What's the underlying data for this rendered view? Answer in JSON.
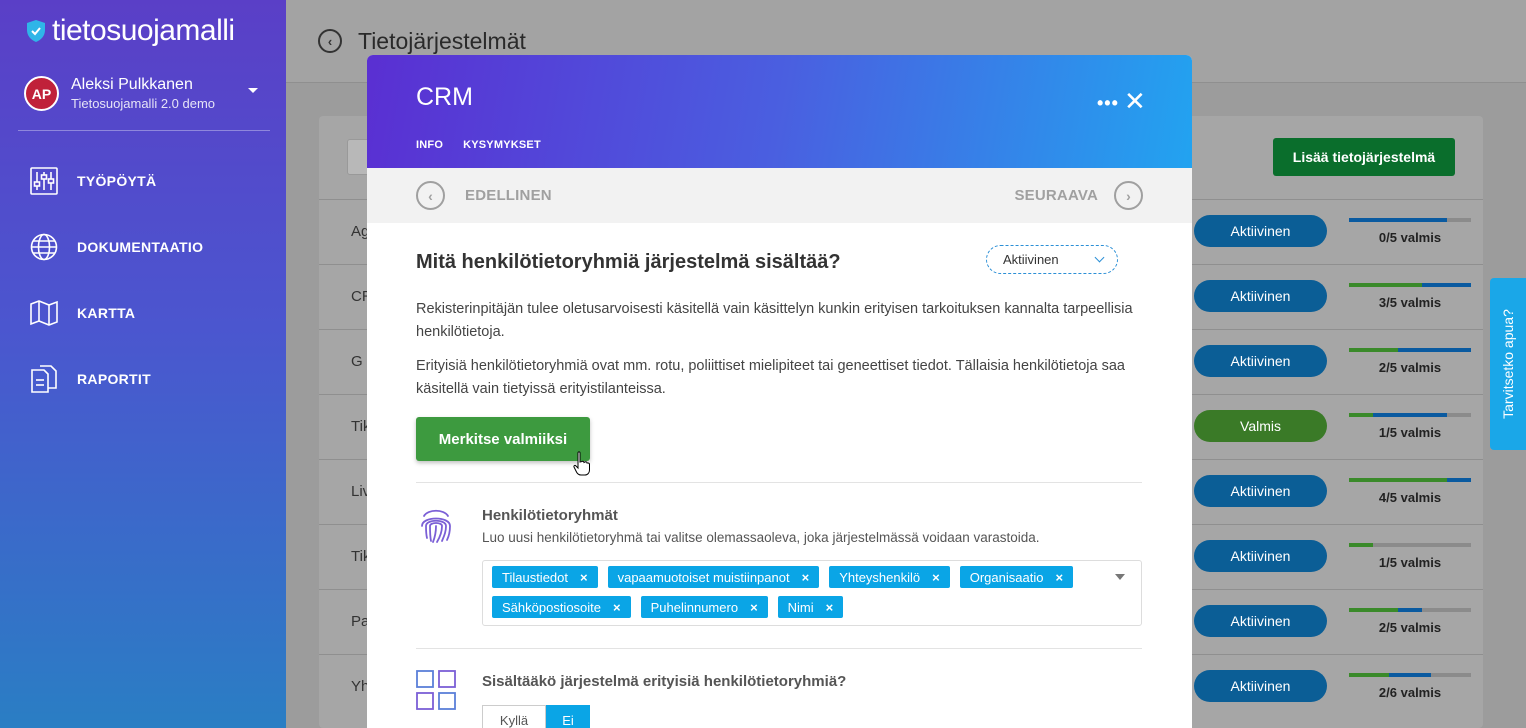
{
  "sidebar": {
    "logo": "tietosuojamalli",
    "user": {
      "initials": "AP",
      "name": "Aleksi Pulkkanen",
      "org": "Tietosuojamalli 2.0 demo"
    },
    "items": [
      {
        "label": "TYÖPÖYTÄ",
        "icon": "sliders-icon"
      },
      {
        "label": "DOKUMENTAATIO",
        "icon": "globe-icon"
      },
      {
        "label": "KARTTA",
        "icon": "map-icon"
      },
      {
        "label": "RAPORTIT",
        "icon": "documents-icon"
      }
    ]
  },
  "page": {
    "title": "Tietojärjestelmät",
    "add_button": "Lisää tietojärjestelmä",
    "rows": [
      {
        "label": "Ag",
        "status": "Aktiivinen",
        "progress_green": 0,
        "progress_blue": 0.8,
        "progress_text": "0/5 valmis"
      },
      {
        "label": "CR",
        "status": "Aktiivinen",
        "progress_green": 0.6,
        "progress_blue": 1.0,
        "progress_text": "3/5 valmis"
      },
      {
        "label": "G",
        "status": "Aktiivinen",
        "progress_green": 0.4,
        "progress_blue": 1.0,
        "progress_text": "2/5 valmis"
      },
      {
        "label": "Tik",
        "status": "Valmis",
        "progress_green": 0.2,
        "progress_blue": 0.8,
        "progress_text": "1/5 valmis"
      },
      {
        "label": "Liv",
        "status": "Aktiivinen",
        "progress_green": 0.8,
        "progress_blue": 1.0,
        "progress_text": "4/5 valmis"
      },
      {
        "label": "Tik",
        "status": "Aktiivinen",
        "progress_green": 0.2,
        "progress_blue": 0.2,
        "progress_text": "1/5 valmis"
      },
      {
        "label": "Pa",
        "status": "Aktiivinen",
        "progress_green": 0.4,
        "progress_blue": 0.6,
        "progress_text": "2/5 valmis"
      },
      {
        "label": "Yh",
        "status": "Aktiivinen",
        "progress_green": 0.33,
        "progress_blue": 0.67,
        "progress_text": "2/6 valmis"
      }
    ]
  },
  "help": {
    "label": "Tarvitsetko apua?"
  },
  "modal": {
    "title": "CRM",
    "more_label": "•••",
    "close_label": "✕",
    "tabs": [
      "INFO",
      "KYSYMYKSET"
    ],
    "prev_label": "EDELLINEN",
    "next_label": "SEURAAVA",
    "question": "Mitä henkilötietoryhmiä järjestelmä sisältää?",
    "status_select": "Aktiivinen",
    "para1": "Rekisterinpitäjän tulee oletusarvoisesti käsitellä vain käsittelyn kunkin erityisen tarkoituksen kannalta tarpeellisia henkilötietoja.",
    "para2": "Erityisiä henkilötietoryhmiä ovat mm. rotu, poliittiset mielipiteet tai geneettiset tiedot. Tällaisia henkilötietoja saa käsitellä vain tietyissä erityistilanteissa.",
    "mark_button": "Merkitse valmiiksi",
    "section1_title": "Henkilötietoryhmät",
    "section1_desc": "Luo uusi henkilötietoryhmä tai valitse olemassaoleva, joka järjestelmässä voidaan varastoida.",
    "tags": [
      "Tilaustiedot",
      "vapaamuotoiset muistiinpanot",
      "Yhteyshenkilö",
      "Organisaatio",
      "Sähköpostiosoite",
      "Puhelinnumero",
      "Nimi"
    ],
    "section2_title": "Sisältääkö järjestelmä erityisiä henkilötietoryhmiä?",
    "yes_label": "Kyllä",
    "no_label": "Ei"
  },
  "colors": {
    "accent": "#0aa5e6",
    "green": "#3d9a3f",
    "sidebar_top": "#5a3fc7",
    "sidebar_bottom": "#2a7ec4"
  }
}
